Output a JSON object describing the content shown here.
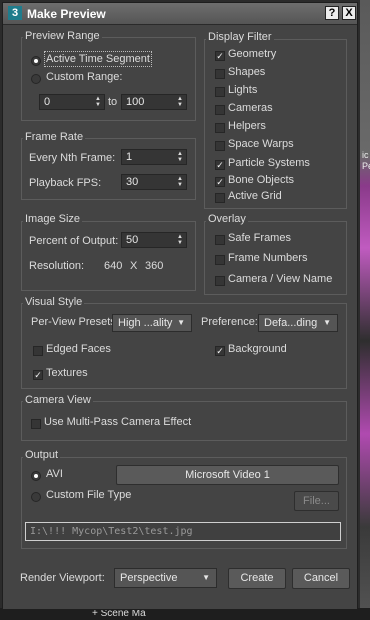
{
  "window": {
    "title": "Make Preview",
    "help_btn": "?",
    "close_btn": "X",
    "app_icon": "3"
  },
  "preview_range": {
    "label": "Preview Range",
    "active_time_segment": "Active Time Segment",
    "custom_range": "Custom Range:",
    "from": "0",
    "to_label": "to",
    "to": "100",
    "selected": "active_time_segment"
  },
  "frame_rate": {
    "label": "Frame Rate",
    "every_nth_label": "Every Nth Frame:",
    "every_nth": "1",
    "playback_fps_label": "Playback FPS:",
    "playback_fps": "30"
  },
  "display_filter": {
    "label": "Display Filter",
    "items": [
      {
        "label": "Geometry",
        "checked": true
      },
      {
        "label": "Shapes",
        "checked": false
      },
      {
        "label": "Lights",
        "checked": false
      },
      {
        "label": "Cameras",
        "checked": false
      },
      {
        "label": "Helpers",
        "checked": false
      },
      {
        "label": "Space Warps",
        "checked": false
      },
      {
        "label": "Particle Systems",
        "checked": true
      },
      {
        "label": "Bone Objects",
        "checked": true
      },
      {
        "label": "Active Grid",
        "checked": false
      }
    ]
  },
  "image_size": {
    "label": "Image Size",
    "percent_label": "Percent of Output:",
    "percent": "50",
    "resolution_label": "Resolution:",
    "res_w": "640",
    "res_x": "X",
    "res_h": "360"
  },
  "overlay": {
    "label": "Overlay",
    "items": [
      {
        "label": "Safe Frames",
        "checked": false
      },
      {
        "label": "Frame Numbers",
        "checked": false
      },
      {
        "label": "Camera / View Name",
        "checked": false
      }
    ]
  },
  "visual_style": {
    "label": "Visual Style",
    "per_view_label": "Per-View Presets",
    "per_view_value": "High ...ality",
    "preference_label": "Preference:",
    "preference_value": "Defa...ding",
    "edged_faces": "Edged Faces",
    "edged_faces_checked": false,
    "background": "Background",
    "background_checked": true,
    "textures": "Textures",
    "textures_checked": true
  },
  "camera_view": {
    "label": "Camera View",
    "multipass": "Use Multi-Pass Camera Effect",
    "multipass_checked": false
  },
  "output": {
    "label": "Output",
    "avi": "AVI",
    "codec": "Microsoft Video 1",
    "custom_file_type": "Custom File Type",
    "file_btn": "File...",
    "path": "I:\\!!! Mycop\\Test2\\test.jpg",
    "selected": "avi"
  },
  "footer": {
    "render_viewport_label": "Render Viewport:",
    "viewport": "Perspective",
    "create": "Create",
    "cancel": "Cancel"
  },
  "background_app": {
    "right_text": "ic\nPe",
    "bottom_text": "+ Scene Ma"
  }
}
